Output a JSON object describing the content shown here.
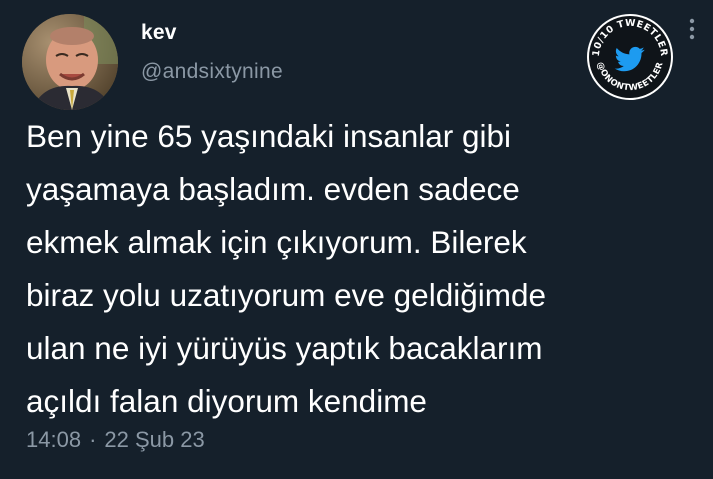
{
  "user": {
    "display_name": "kev",
    "handle": "@andsixtynine",
    "avatar_icon": "user-avatar"
  },
  "badge": {
    "top_text": "10/10 TWEETLER",
    "bottom_text": "@ONONTWEETLER",
    "icon": "twitter-bird-icon",
    "color": "#1d9bf0"
  },
  "more_icon": "more-vertical-icon",
  "tweet": {
    "text": "Ben yine 65 yaşındaki insanlar gibi\nyaşamaya başladım. evden sadece\nekmek almak için çıkıyorum. Bilerek\nbiraz yolu uzatıyorum eve geldiğimde\nulan ne iyi yürüyüs yaptık bacaklarım\naçıldı falan diyorum kendime",
    "time": "14:08",
    "separator": "·",
    "date": "22 Şub 23"
  },
  "colors": {
    "background": "#15202b",
    "text": "#ffffff",
    "secondary": "#8b98a5"
  }
}
